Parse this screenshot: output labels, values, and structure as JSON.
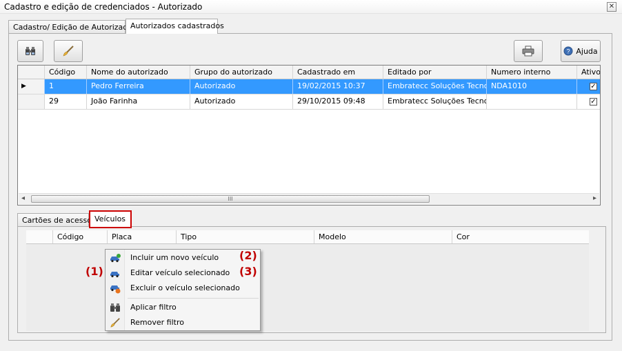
{
  "window": {
    "title": "Cadastro e edição de credenciados - Autorizado",
    "close_label": "✕"
  },
  "top_tabs": [
    {
      "label": "Cadastro/ Edição de Autorizados",
      "active": false
    },
    {
      "label": "Autorizados cadastrados",
      "active": true
    }
  ],
  "toolbar": {
    "filter_icon": "binoculars-icon",
    "clear_icon": "brush-icon",
    "print_icon": "printer-icon",
    "help_label": "Ajuda",
    "help_icon": "help-icon"
  },
  "authorized_table": {
    "columns": [
      "Código",
      "Nome do autorizado",
      "Grupo do autorizado",
      "Cadastrado em",
      "Editado por",
      "Numero interno",
      "Ativo"
    ],
    "rows": [
      {
        "codigo": "1",
        "nome": "Pedro Ferreira",
        "grupo": "Autorizado",
        "cadastrado": "19/02/2015 10:37",
        "editado": "Embratecc Soluções Tecno...",
        "numero": "NDA1010",
        "ativo": true,
        "selected": true
      },
      {
        "codigo": "29",
        "nome": "João Farinha",
        "grupo": "Autorizado",
        "cadastrado": "29/10/2015 09:48",
        "editado": "Embratecc Soluções Tecno...",
        "numero": "",
        "ativo": true,
        "selected": false
      }
    ],
    "scroll_left": "◂",
    "scroll_right": "▸",
    "scroll_grip": "III"
  },
  "bottom_tabs": [
    {
      "label": "Cartões de acesso",
      "active": false
    },
    {
      "label": "Veículos",
      "active": true
    }
  ],
  "vehicle_table": {
    "columns": [
      "Código",
      "Placa",
      "Tipo",
      "Modelo",
      "Cor"
    ]
  },
  "context_menu": {
    "items": [
      {
        "label": "Incluir um novo veículo",
        "icon": "car-add-icon"
      },
      {
        "label": "Editar veículo selecionado",
        "icon": "car-edit-icon"
      },
      {
        "label": "Excluir o veículo selecionado",
        "icon": "car-delete-icon"
      },
      {
        "label": "Aplicar filtro",
        "icon": "binoculars-icon"
      },
      {
        "label": "Remover filtro",
        "icon": "brush-icon"
      }
    ]
  },
  "annotations": {
    "one": "(1)",
    "two": "(2)",
    "three": "(3)"
  },
  "colors": {
    "selection": "#3399ff",
    "annotation": "#c00000",
    "highlight_border": "#cc0000"
  }
}
